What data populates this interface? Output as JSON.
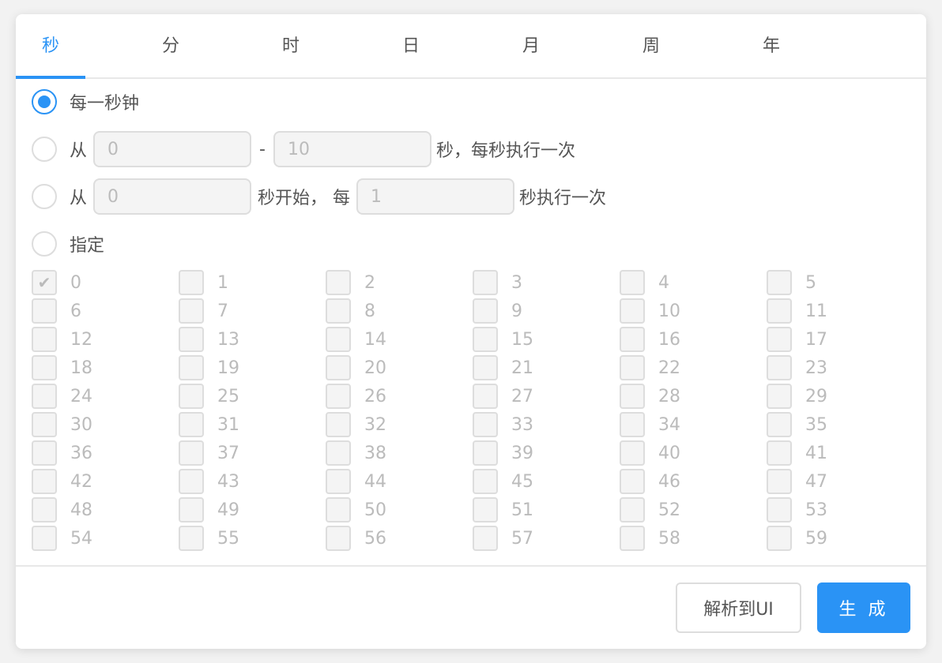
{
  "tabs": [
    "秒",
    "分",
    "时",
    "日",
    "月",
    "周",
    "年"
  ],
  "active_tab": 0,
  "accent": "#2a93f5",
  "options": {
    "every": "每一秒钟",
    "range": {
      "from_label": "从",
      "from_value": "0",
      "sep": "-",
      "to_value": "10",
      "suffix": "秒，每秒执行一次"
    },
    "step": {
      "from_label": "从",
      "start_value": "0",
      "mid": "秒开始， 每",
      "step_value": "1",
      "suffix": "秒执行一次"
    },
    "specify": "指定"
  },
  "selected_option": "every",
  "checked": [
    0
  ],
  "seconds": [
    "0",
    "1",
    "2",
    "3",
    "4",
    "5",
    "6",
    "7",
    "8",
    "9",
    "10",
    "11",
    "12",
    "13",
    "14",
    "15",
    "16",
    "17",
    "18",
    "19",
    "20",
    "21",
    "22",
    "23",
    "24",
    "25",
    "26",
    "27",
    "28",
    "29",
    "30",
    "31",
    "32",
    "33",
    "34",
    "35",
    "36",
    "37",
    "38",
    "39",
    "40",
    "41",
    "42",
    "43",
    "44",
    "45",
    "46",
    "47",
    "48",
    "49",
    "50",
    "51",
    "52",
    "53",
    "54",
    "55",
    "56",
    "57",
    "58",
    "59"
  ],
  "buttons": {
    "parse": "解析到UI",
    "generate": "生 成"
  }
}
